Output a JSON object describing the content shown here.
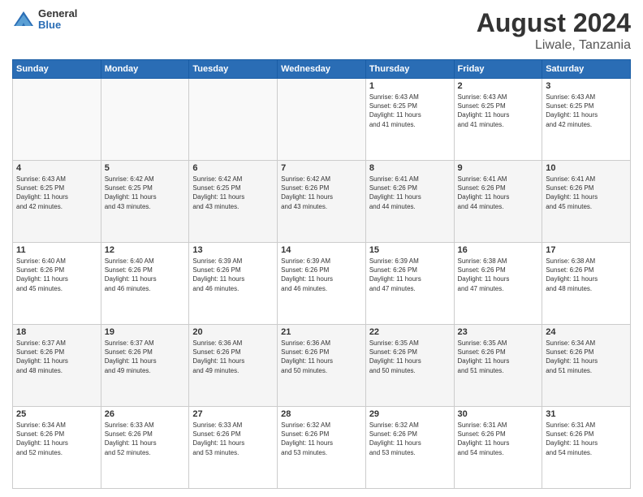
{
  "logo": {
    "general": "General",
    "blue": "Blue"
  },
  "title": {
    "month_year": "August 2024",
    "location": "Liwale, Tanzania"
  },
  "header_days": [
    "Sunday",
    "Monday",
    "Tuesday",
    "Wednesday",
    "Thursday",
    "Friday",
    "Saturday"
  ],
  "weeks": [
    {
      "days": [
        {
          "num": "",
          "info": ""
        },
        {
          "num": "",
          "info": ""
        },
        {
          "num": "",
          "info": ""
        },
        {
          "num": "",
          "info": ""
        },
        {
          "num": "1",
          "info": "Sunrise: 6:43 AM\nSunset: 6:25 PM\nDaylight: 11 hours\nand 41 minutes."
        },
        {
          "num": "2",
          "info": "Sunrise: 6:43 AM\nSunset: 6:25 PM\nDaylight: 11 hours\nand 41 minutes."
        },
        {
          "num": "3",
          "info": "Sunrise: 6:43 AM\nSunset: 6:25 PM\nDaylight: 11 hours\nand 42 minutes."
        }
      ],
      "alt": false
    },
    {
      "days": [
        {
          "num": "4",
          "info": "Sunrise: 6:43 AM\nSunset: 6:25 PM\nDaylight: 11 hours\nand 42 minutes."
        },
        {
          "num": "5",
          "info": "Sunrise: 6:42 AM\nSunset: 6:25 PM\nDaylight: 11 hours\nand 43 minutes."
        },
        {
          "num": "6",
          "info": "Sunrise: 6:42 AM\nSunset: 6:25 PM\nDaylight: 11 hours\nand 43 minutes."
        },
        {
          "num": "7",
          "info": "Sunrise: 6:42 AM\nSunset: 6:26 PM\nDaylight: 11 hours\nand 43 minutes."
        },
        {
          "num": "8",
          "info": "Sunrise: 6:41 AM\nSunset: 6:26 PM\nDaylight: 11 hours\nand 44 minutes."
        },
        {
          "num": "9",
          "info": "Sunrise: 6:41 AM\nSunset: 6:26 PM\nDaylight: 11 hours\nand 44 minutes."
        },
        {
          "num": "10",
          "info": "Sunrise: 6:41 AM\nSunset: 6:26 PM\nDaylight: 11 hours\nand 45 minutes."
        }
      ],
      "alt": true
    },
    {
      "days": [
        {
          "num": "11",
          "info": "Sunrise: 6:40 AM\nSunset: 6:26 PM\nDaylight: 11 hours\nand 45 minutes."
        },
        {
          "num": "12",
          "info": "Sunrise: 6:40 AM\nSunset: 6:26 PM\nDaylight: 11 hours\nand 46 minutes."
        },
        {
          "num": "13",
          "info": "Sunrise: 6:39 AM\nSunset: 6:26 PM\nDaylight: 11 hours\nand 46 minutes."
        },
        {
          "num": "14",
          "info": "Sunrise: 6:39 AM\nSunset: 6:26 PM\nDaylight: 11 hours\nand 46 minutes."
        },
        {
          "num": "15",
          "info": "Sunrise: 6:39 AM\nSunset: 6:26 PM\nDaylight: 11 hours\nand 47 minutes."
        },
        {
          "num": "16",
          "info": "Sunrise: 6:38 AM\nSunset: 6:26 PM\nDaylight: 11 hours\nand 47 minutes."
        },
        {
          "num": "17",
          "info": "Sunrise: 6:38 AM\nSunset: 6:26 PM\nDaylight: 11 hours\nand 48 minutes."
        }
      ],
      "alt": false
    },
    {
      "days": [
        {
          "num": "18",
          "info": "Sunrise: 6:37 AM\nSunset: 6:26 PM\nDaylight: 11 hours\nand 48 minutes."
        },
        {
          "num": "19",
          "info": "Sunrise: 6:37 AM\nSunset: 6:26 PM\nDaylight: 11 hours\nand 49 minutes."
        },
        {
          "num": "20",
          "info": "Sunrise: 6:36 AM\nSunset: 6:26 PM\nDaylight: 11 hours\nand 49 minutes."
        },
        {
          "num": "21",
          "info": "Sunrise: 6:36 AM\nSunset: 6:26 PM\nDaylight: 11 hours\nand 50 minutes."
        },
        {
          "num": "22",
          "info": "Sunrise: 6:35 AM\nSunset: 6:26 PM\nDaylight: 11 hours\nand 50 minutes."
        },
        {
          "num": "23",
          "info": "Sunrise: 6:35 AM\nSunset: 6:26 PM\nDaylight: 11 hours\nand 51 minutes."
        },
        {
          "num": "24",
          "info": "Sunrise: 6:34 AM\nSunset: 6:26 PM\nDaylight: 11 hours\nand 51 minutes."
        }
      ],
      "alt": true
    },
    {
      "days": [
        {
          "num": "25",
          "info": "Sunrise: 6:34 AM\nSunset: 6:26 PM\nDaylight: 11 hours\nand 52 minutes."
        },
        {
          "num": "26",
          "info": "Sunrise: 6:33 AM\nSunset: 6:26 PM\nDaylight: 11 hours\nand 52 minutes."
        },
        {
          "num": "27",
          "info": "Sunrise: 6:33 AM\nSunset: 6:26 PM\nDaylight: 11 hours\nand 53 minutes."
        },
        {
          "num": "28",
          "info": "Sunrise: 6:32 AM\nSunset: 6:26 PM\nDaylight: 11 hours\nand 53 minutes."
        },
        {
          "num": "29",
          "info": "Sunrise: 6:32 AM\nSunset: 6:26 PM\nDaylight: 11 hours\nand 53 minutes."
        },
        {
          "num": "30",
          "info": "Sunrise: 6:31 AM\nSunset: 6:26 PM\nDaylight: 11 hours\nand 54 minutes."
        },
        {
          "num": "31",
          "info": "Sunrise: 6:31 AM\nSunset: 6:26 PM\nDaylight: 11 hours\nand 54 minutes."
        }
      ],
      "alt": false
    }
  ]
}
